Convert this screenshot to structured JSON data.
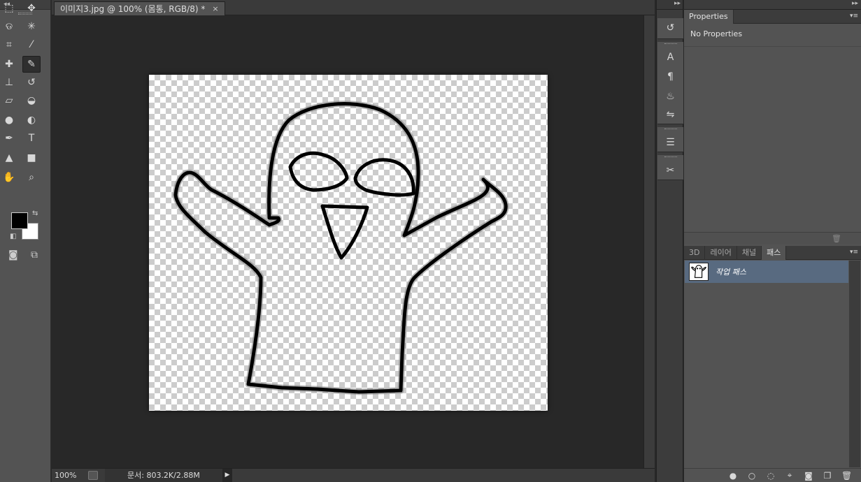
{
  "document_tab": {
    "title": "이미지3.jpg @ 100% (몸통, RGB/8) *",
    "close": "×"
  },
  "toolbar": {
    "collapse": "◂◂",
    "tools": [
      {
        "name": "rect-marquee-icon",
        "glyph": "⬚"
      },
      {
        "name": "move-icon",
        "glyph": "✥"
      },
      {
        "name": "lasso-icon",
        "glyph": "ଡ"
      },
      {
        "name": "magic-wand-icon",
        "glyph": "✳"
      },
      {
        "name": "crop-icon",
        "glyph": "⌗"
      },
      {
        "name": "eyedropper-icon",
        "glyph": "⁄"
      },
      {
        "name": "healing-brush-icon",
        "glyph": "✚"
      },
      {
        "name": "brush-icon",
        "glyph": "✎"
      },
      {
        "name": "clone-stamp-icon",
        "glyph": "⊥"
      },
      {
        "name": "history-brush-icon",
        "glyph": "↺"
      },
      {
        "name": "eraser-icon",
        "glyph": "▱"
      },
      {
        "name": "paint-bucket-icon",
        "glyph": "◒"
      },
      {
        "name": "blur-icon",
        "glyph": "●"
      },
      {
        "name": "dodge-icon",
        "glyph": "◐"
      },
      {
        "name": "pen-icon",
        "glyph": "✒"
      },
      {
        "name": "type-icon",
        "glyph": "T"
      },
      {
        "name": "path-select-icon",
        "glyph": "▲"
      },
      {
        "name": "rectangle-shape-icon",
        "glyph": "■"
      },
      {
        "name": "hand-icon",
        "glyph": "✋"
      },
      {
        "name": "zoom-icon",
        "glyph": "⌕"
      }
    ],
    "quick_mask": "◙",
    "screen_mode": "⧉"
  },
  "status": {
    "zoom": "100%",
    "doc_info": "문서: 803.2K/2.88M",
    "arrow": "▶"
  },
  "dock": {
    "expand": "▸▸",
    "icons": [
      "↺",
      "A",
      "¶",
      "♨",
      "⇋",
      "☰",
      "✂"
    ]
  },
  "right_panel": {
    "expand": "▸▸",
    "properties_tab": "Properties",
    "no_properties": "No Properties",
    "menu": "▾≡",
    "trash": "🗑",
    "paths_tabs": [
      "3D",
      "레이어",
      "채널",
      "패스"
    ],
    "active_paths_tab": "패스",
    "path_item": "작업 패스",
    "footer_icons": [
      "●",
      "○",
      "◌",
      "⌖",
      "◙",
      "❐",
      "🗑"
    ]
  },
  "colors": {
    "foreground": "#000000",
    "background": "#ffffff",
    "selection": "#586a80"
  }
}
